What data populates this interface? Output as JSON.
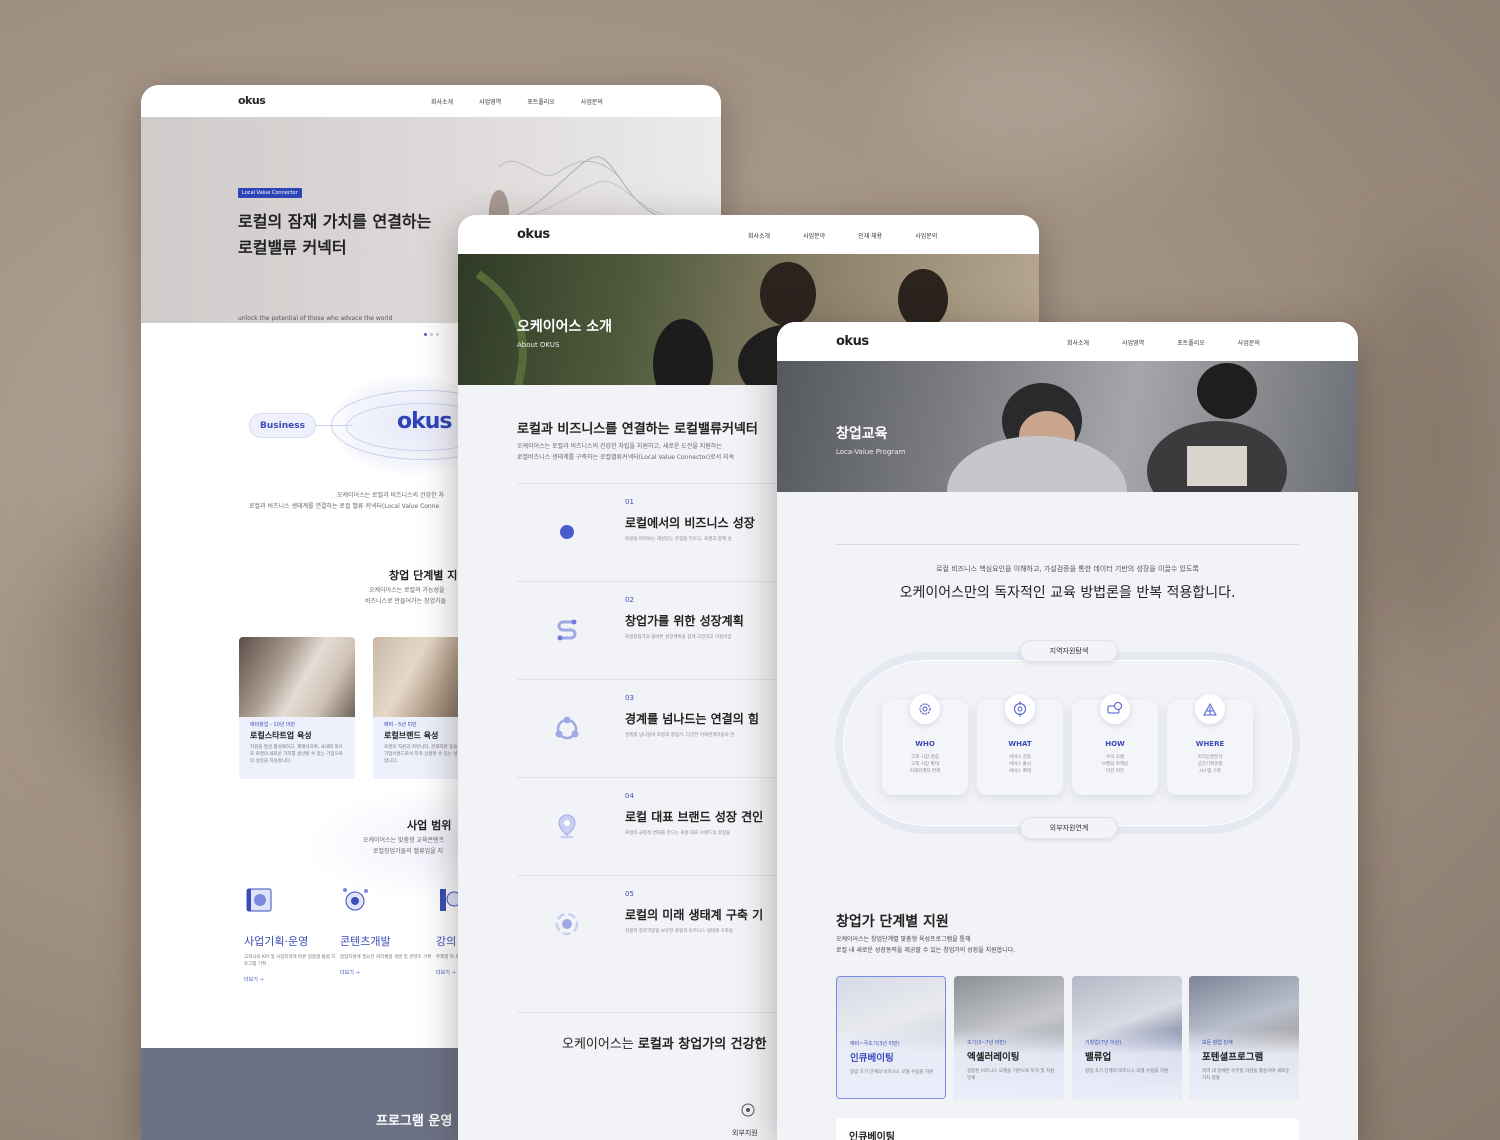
{
  "brand": {
    "logo": "okus",
    "accent": "#2e45b8"
  },
  "card1": {
    "nav": [
      "회사소개",
      "사업영역",
      "포트폴리오",
      "사업문의"
    ],
    "hero_badge": "Local Value Connector",
    "hero_title_1": "로컬의 잠재 가치를 연결하는",
    "hero_title_2": "로컬밸류 커넥터",
    "hero_sub": "unlock the potential of those who advace the world",
    "business_pill": "Business",
    "intro_1": "오케이어스는 로컬과 비즈니스의 건강한 자",
    "intro_2": "로컬과 비즈니스 생태계를 연결하는 로컬 밸류 커넥터(Local Value Conne",
    "stage_title": "창업 단계별 지",
    "stage_desc_1": "오케이어스는 로컬의 가능성을",
    "stage_desc_2": "비즈니스로 만들어가는 창업가들",
    "programs": [
      {
        "tag": "예비창업 - 10년 미만",
        "name": "로컬스타트업 육성",
        "desc": "지원을 발굴 활성화하고, 재해석하여, 국내외 적으로 로컬의 새로운 가치를 생산할 수 있는 기업으로의 성장을 지원합니다."
      },
      {
        "tag": "예비 - 5년 미만",
        "name": "로컬브랜드 육성",
        "desc": "로컬의 자원과 커뮤니티, 문화자원 등을 활용하여 가업브랜드로서 지역 상생할 수 있는 성장을 지원합니다."
      }
    ],
    "scope_title": "사업 범위",
    "scope_desc_1": "오케이어스는 맞춤형 교육콘텐츠",
    "scope_desc_2": "로컬창업가들의 밸류업을 지",
    "services": [
      {
        "name": "사업기획·운영",
        "desc": "고객사의 KPI 및 사업목적에 따른 맞춤형 통합 프로그램 기획",
        "more": "더보기 →"
      },
      {
        "name": "콘텐츠개발",
        "desc": "창업지원에 필요한 커리큘럼 개발 및 콘텐츠 기획",
        "more": "더보기 →"
      },
      {
        "name": "강의",
        "desc": "주제별 특 로 개발 및",
        "more": "더보기 →"
      }
    ],
    "footer_title": "프로그램 운영"
  },
  "card2": {
    "nav": [
      "회사소개",
      "사업분야",
      "인재 채용",
      "사업문의"
    ],
    "hero_title": "오케이어스 소개",
    "hero_sub": "About OKUS",
    "section_title": "로컬과 비즈니스를 연결하는 로컬밸류커넥터",
    "section_desc_1": "오케이어스는 로컬과 비즈니스의 건강한 자립을 지원하고, 새로운 도전을 지원하는",
    "section_desc_2": "로컬비즈니스 생태계를 구축하는 로컬밸류커넥터(Local Value Connector)로서 지속",
    "items": [
      {
        "no": "01",
        "title": "로컬에서의 비즈니스 성장",
        "desc": "로컬을 바라보는 개성있는 관점을 키우고, 로컬과 함께 성"
      },
      {
        "no": "02",
        "title": "창업가를 위한 성장계획",
        "desc": "로컬창업가의 올바른 성장계획을 함께 고민하고 이끌어갑"
      },
      {
        "no": "03",
        "title": "경계를 넘나드는 연결의 힘",
        "desc": "경계를 넘나들며 로컬과 창업가, 다양한 이해관계자들의 연"
      },
      {
        "no": "04",
        "title": "로컬 대표 브랜드 성장 견인",
        "desc": "로컬의 긍정적 변화를 만드는 로컬 대표 브랜드의 성장을"
      },
      {
        "no": "05",
        "title": "로컬의 미래 생태계 구축 기",
        "desc": "자생적 창조역량을 보유한 로컬과 비즈니스 생태계 구축을"
      }
    ],
    "bottom_text_a": "오케이어스는 ",
    "bottom_text_b": "로컬과 창업가의 건강한",
    "bottom_label": "외부지원"
  },
  "card3": {
    "nav": [
      "회사소개",
      "사업영역",
      "포트폴리오",
      "사업문의"
    ],
    "hero_title": "창업교육",
    "hero_sub": "Loca-Value Program",
    "intro_small": "로컬 비즈니스 핵심요인을 이해하고, 가설검증을 통한 데이터 기반의 성장을 이끌수 있도록",
    "intro_big": "오케이어스만의 독자적인 교육 방법론을 반복 적용합니다.",
    "top_pill": "지역자원탐색",
    "bottom_pill": "외부자원연계",
    "steps": [
      {
        "icon": "gear-icon",
        "name": "WHO",
        "desc_1": "고객 시장 검증",
        "desc_2": "고객 시장 확대",
        "desc_3": "이해관계자 연계"
      },
      {
        "icon": "target-icon",
        "name": "WHAT",
        "desc_1": "서비스 검증",
        "desc_2": "서비스 출시",
        "desc_3": "서비스 확대"
      },
      {
        "icon": "money-icon",
        "name": "HOW",
        "desc_1": "수익 모델",
        "desc_2": "브랜딩 마케팅",
        "desc_3": "미션 비전"
      },
      {
        "icon": "building-icon",
        "name": "WHERE",
        "desc_1": "지역상권분석",
        "desc_2": "공간기획운영",
        "desc_3": "시스템 구축"
      }
    ],
    "stage_title": "창업가 단계별 지원",
    "stage_desc_1": "오케이어스는 창업단계별 맞춤형 육성프로그램을 통해",
    "stage_desc_2": "로컬 내 새로운 성장동력을 제공할 수 있는 창업가의 성장을 지원합니다.",
    "stages": [
      {
        "tag": "예비~극초기(3년 미만)",
        "name": "인큐베이팅",
        "desc": "창업 초기 단계의 비즈니스 모델 수립을 지원"
      },
      {
        "tag": "초기(3~7년 미만)",
        "name": "엑셀러레이팅",
        "desc": "검증된 비즈니스 모델을 기반으로 투자 및 자원연계"
      },
      {
        "tag": "기창업(7년 이상)",
        "name": "밸류업",
        "desc": "창업 초기 단계의 비즈니스 모델 수립을 지원"
      },
      {
        "tag": "모든 창업 단계",
        "name": "포텐셜프로그램",
        "desc": "지역 내 정체된 유무형 자원을 활용하여 새로운 가치 창출"
      }
    ],
    "bottom_box_title": "인큐베이팅"
  }
}
